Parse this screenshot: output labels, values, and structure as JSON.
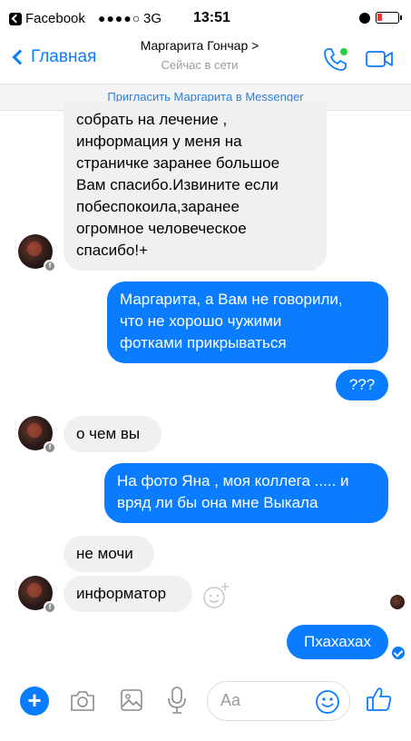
{
  "status_bar": {
    "carrier": "Facebook",
    "signal": "●●●●○",
    "network": "3G",
    "time": "13:51"
  },
  "header": {
    "back_label": "Главная",
    "contact_name": "Маргарита Гончар >",
    "contact_status": "Сейчас в сети"
  },
  "invite_bar": {
    "text": "Пригласить Маргарита  в Messenger"
  },
  "messages": [
    {
      "from": "them",
      "text": "собрать на лечение ,\nинформация у меня на\nстраничке  заранее большое\nВам спасибо.Извините если\nпобеспокоила,заранее\nогромное человеческое\nспасибо!+"
    },
    {
      "from": "me",
      "text": "Маргарита, а Вам не говорили,\nчто не хорошо чужими\nфотками прикрываться"
    },
    {
      "from": "me",
      "text": "???"
    },
    {
      "from": "them",
      "text": "о чем вы"
    },
    {
      "from": "me",
      "text": "На фото Яна , моя коллега ..... и\nвряд ли бы она мне Выкала"
    },
    {
      "from": "them",
      "text": "не мочи"
    },
    {
      "from": "them",
      "text": "информатор"
    },
    {
      "from": "me",
      "text": "Пхахахах"
    }
  ],
  "composer": {
    "placeholder": "Aa"
  },
  "colors": {
    "accent": "#0a7cff",
    "incoming_bubble": "#f1f0f0",
    "invite_text": "#2f7fd8"
  },
  "icons": [
    "back-chevron-icon",
    "phone-icon",
    "video-camera-icon",
    "plus-icon",
    "camera-icon",
    "image-icon",
    "microphone-icon",
    "emoji-icon",
    "thumbs-up-icon"
  ]
}
